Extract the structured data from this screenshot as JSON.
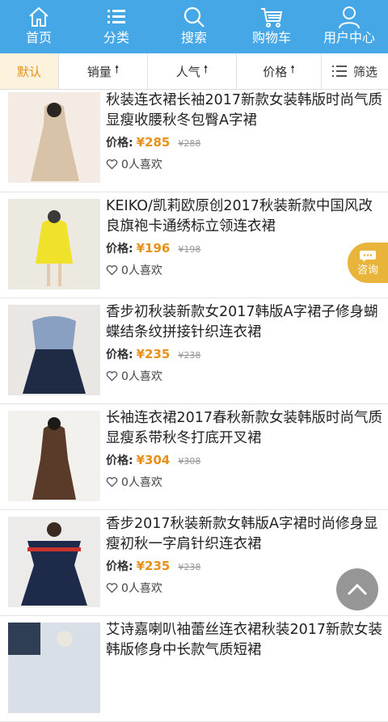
{
  "nav": {
    "home": "首页",
    "category": "分类",
    "search": "搜索",
    "cart": "购物车",
    "user": "用户中心"
  },
  "filters": {
    "default": "默认",
    "sales": "销量",
    "popularity": "人气",
    "price": "价格",
    "filter": "筛选"
  },
  "filter_arrow": "🠕",
  "products": [
    {
      "title": "秋装连衣裙长袖2017新款女装韩版时尚气质显瘦收腰秋冬包臀A字裙",
      "price_label": "价格:",
      "price": "¥285",
      "old_price": "¥288",
      "likes": "0人喜欢",
      "image_colors": [
        "#f4ece4",
        "#d9c3a8",
        "#2b2522"
      ]
    },
    {
      "title": "KEIKO/凯莉欧原创2017秋装新款中国风改良旗袍卡通绣标立领连衣裙",
      "price_label": "价格:",
      "price": "¥196",
      "old_price": "¥198",
      "likes": "0人喜欢",
      "image_colors": [
        "#ece9e0",
        "#f0e12a",
        "#3a3a3a"
      ]
    },
    {
      "title": "香步初秋装新款女2017韩版A字裙子修身蝴蝶结条纹拼接针织连衣裙",
      "price_label": "价格:",
      "price": "¥235",
      "old_price": "¥238",
      "likes": "0人喜欢",
      "image_colors": [
        "#e9e6e4",
        "#8aa0c3",
        "#1f2a45"
      ]
    },
    {
      "title": "长袖连衣裙2017春秋新款女装韩版时尚气质显瘦系带秋冬打底开叉裙",
      "price_label": "价格:",
      "price": "¥304",
      "old_price": "¥308",
      "likes": "0人喜欢",
      "image_colors": [
        "#f3f1ee",
        "#5a3a28",
        "#1e1a18"
      ]
    },
    {
      "title": "香步2017秋装新款女韩版A字裙时尚修身显瘦初秋一字肩针织连衣裙",
      "price_label": "价格:",
      "price": "¥235",
      "old_price": "¥238",
      "likes": "0人喜欢",
      "image_colors": [
        "#ecebea",
        "#1e2a4a",
        "#c8322d"
      ]
    },
    {
      "title": "艾诗嘉喇叭袖蕾丝连衣裙秋装2017新款女装韩版修身中长款气质短裙",
      "price_label": "价格:",
      "price": "",
      "old_price": "",
      "likes": "",
      "image_colors": [
        "#d8dfe6",
        "#2f3d55",
        "#eae6e0"
      ]
    }
  ],
  "consult": "咨询",
  "colors": {
    "nav_bg": "#45a7e6",
    "accent": "#e8901a",
    "active_filter_bg": "#fdf3dc",
    "consult_bg": "#e8b53a"
  }
}
